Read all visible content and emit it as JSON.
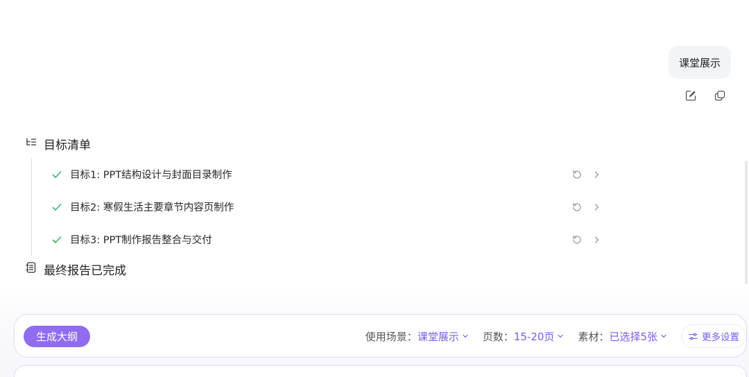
{
  "user_message": "课堂展示",
  "goals": {
    "header": "目标清单",
    "items": [
      {
        "label": "目标1: PPT结构设计与封面目录制作"
      },
      {
        "label": "目标2: 寒假生活主要章节内容页制作"
      },
      {
        "label": "目标3: PPT制作报告整合与交付"
      }
    ]
  },
  "report_status": "最终报告已完成",
  "toolbar": {
    "generate_label": "生成大纲",
    "scene_label": "使用场景：",
    "scene_value": "课堂展示",
    "pages_label": "页数：",
    "pages_value": "15-20页",
    "material_label": "素材：",
    "material_value": "已选择5张",
    "more_label": "更多设置"
  },
  "colors": {
    "accent": "#8f6cf0",
    "accent_text": "#7a5ce6",
    "check": "#3bb36a"
  }
}
